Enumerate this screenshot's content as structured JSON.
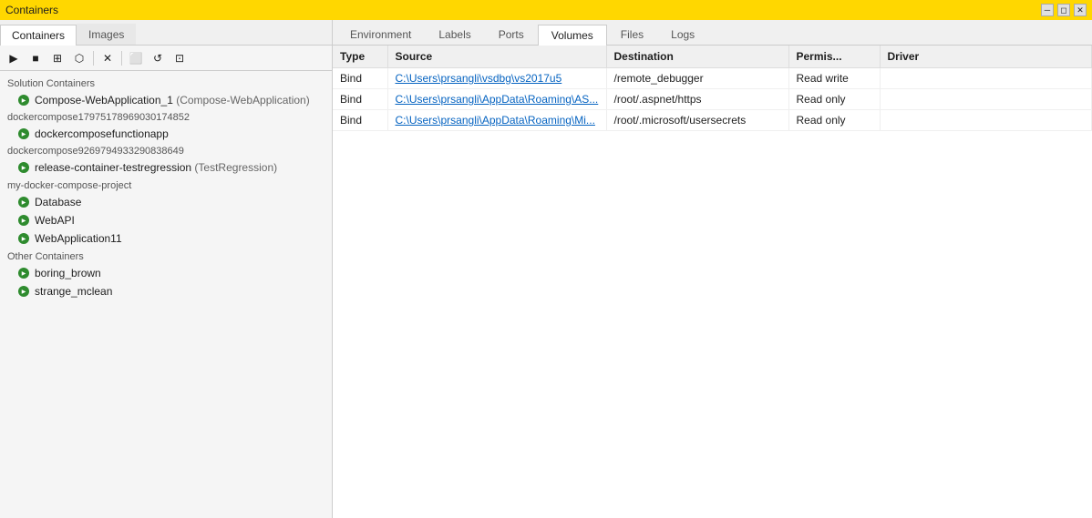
{
  "titleBar": {
    "title": "Containers",
    "controls": [
      "minimize",
      "restore",
      "close"
    ]
  },
  "leftPanel": {
    "tabs": [
      {
        "label": "Containers",
        "active": true
      },
      {
        "label": "Images",
        "active": false
      }
    ],
    "toolbar": {
      "buttons": [
        {
          "name": "run",
          "icon": "▶",
          "disabled": false
        },
        {
          "name": "stop",
          "icon": "■",
          "disabled": false
        },
        {
          "name": "attach",
          "icon": "⊞",
          "disabled": false
        },
        {
          "name": "exec",
          "icon": "⊡",
          "disabled": false
        },
        {
          "name": "delete",
          "icon": "✕",
          "disabled": false
        },
        {
          "name": "browse",
          "icon": "⬜",
          "disabled": false
        },
        {
          "name": "refresh",
          "icon": "↺",
          "disabled": false
        },
        {
          "name": "more",
          "icon": "⊞",
          "disabled": false
        }
      ]
    },
    "groups": [
      {
        "name": "Solution Containers",
        "items": [
          {
            "label": "Compose-WebApplication_1",
            "sublabel": "(Compose-WebApplication)",
            "running": true
          }
        ]
      },
      {
        "groupId": "dockercompose17975178969030174852",
        "items": [
          {
            "label": "dockercomposefunctionapp",
            "running": true
          }
        ]
      },
      {
        "groupId": "dockercompose9269794933290838649",
        "items": [
          {
            "label": "release-container-testregression",
            "sublabel": "(TestRegression)",
            "running": true
          }
        ]
      },
      {
        "name": "my-docker-compose-project",
        "items": [
          {
            "label": "Database",
            "running": true
          },
          {
            "label": "WebAPI",
            "running": true
          },
          {
            "label": "WebApplication11",
            "running": true
          }
        ]
      },
      {
        "name": "Other Containers",
        "items": [
          {
            "label": "boring_brown",
            "running": true
          },
          {
            "label": "strange_mclean",
            "running": true
          }
        ]
      }
    ]
  },
  "rightPanel": {
    "tabs": [
      {
        "label": "Environment",
        "active": false
      },
      {
        "label": "Labels",
        "active": false
      },
      {
        "label": "Ports",
        "active": false
      },
      {
        "label": "Volumes",
        "active": true
      },
      {
        "label": "Files",
        "active": false
      },
      {
        "label": "Logs",
        "active": false
      }
    ],
    "table": {
      "columns": [
        "Type",
        "Source",
        "Destination",
        "Permis...",
        "Driver"
      ],
      "rows": [
        {
          "type": "Bind",
          "source": "C:\\Users\\prsangli\\vsdbg\\vs2017u5",
          "destination": "/remote_debugger",
          "permissions": "Read write",
          "driver": ""
        },
        {
          "type": "Bind",
          "source": "C:\\Users\\prsangli\\AppData\\Roaming\\AS...",
          "destination": "/root/.aspnet/https",
          "permissions": "Read only",
          "driver": ""
        },
        {
          "type": "Bind",
          "source": "C:\\Users\\prsangli\\AppData\\Roaming\\Mi...",
          "destination": "/root/.microsoft/usersecrets",
          "permissions": "Read only",
          "driver": ""
        }
      ]
    }
  }
}
